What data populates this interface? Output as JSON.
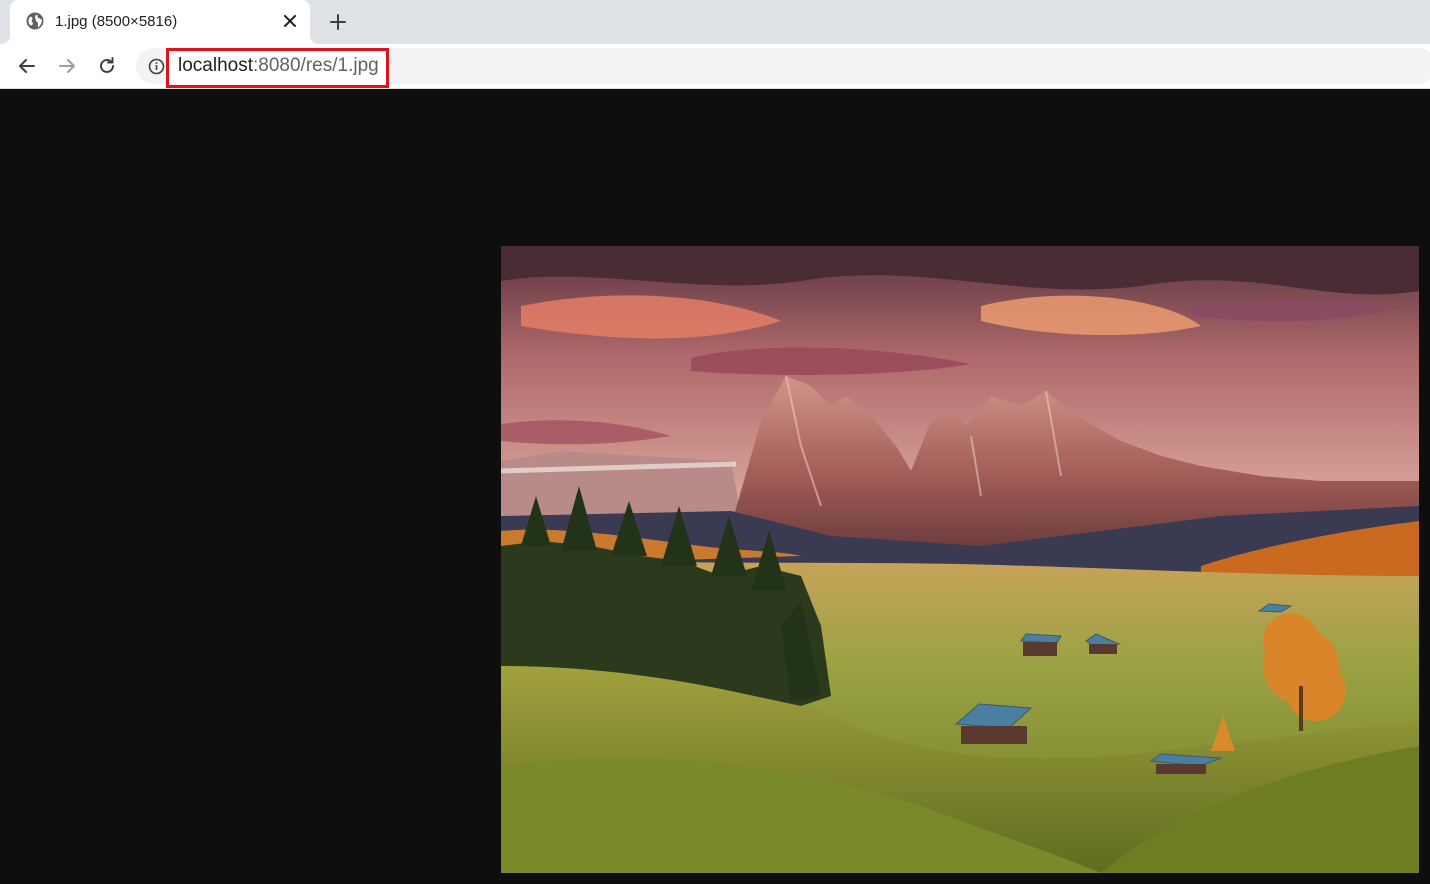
{
  "tab": {
    "title": "1.jpg (8500×5816)",
    "favicon": "globe-icon",
    "close_icon": "close-icon"
  },
  "new_tab_icon": "plus-icon",
  "toolbar": {
    "back_icon": "arrow-left-icon",
    "forward_icon": "arrow-right-icon",
    "reload_icon": "reload-icon",
    "info_icon": "info-icon"
  },
  "address_bar": {
    "host": "localhost",
    "path": ":8080/res/1.jpg",
    "highlight_color": "#e0121c"
  },
  "viewer": {
    "background": "#0e0e0e",
    "image_alt": "1.jpg",
    "image_description": "mountain landscape at sunset"
  }
}
